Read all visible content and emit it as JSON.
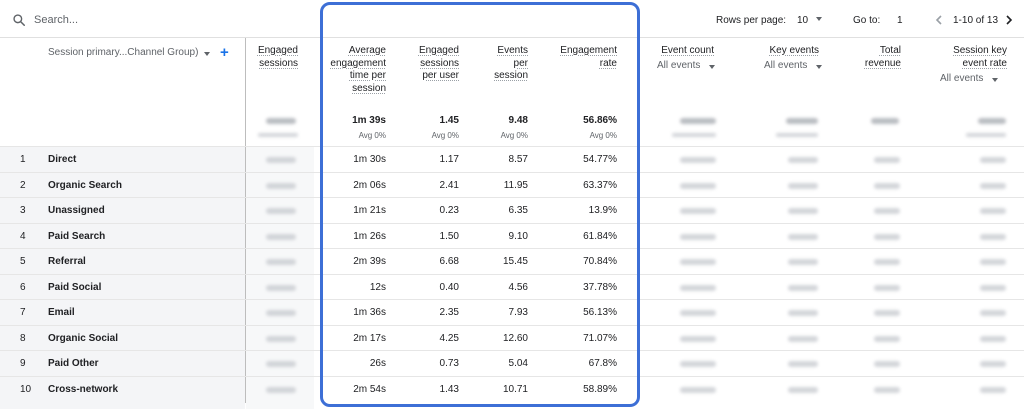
{
  "search": {
    "placeholder": "Search..."
  },
  "pagination": {
    "rows_per_page_label": "Rows per page:",
    "rows_per_page_value": "10",
    "goto_label": "Go to:",
    "goto_value": "1",
    "range_label": "1-10 of 13"
  },
  "dimension": {
    "label": "Session primary...Channel Group)"
  },
  "columns": {
    "engaged_sessions": [
      "Engaged",
      "sessions"
    ],
    "avg_engagement": [
      "Average",
      "engagement",
      "time per",
      "session"
    ],
    "eng_per_user": [
      "Engaged",
      "sessions",
      "per user"
    ],
    "events_per_session": [
      "Events",
      "per",
      "session"
    ],
    "engagement_rate": [
      "Engagement",
      "rate"
    ],
    "event_count": "Event count",
    "event_count_filter": "All events",
    "key_events": "Key events",
    "key_events_filter": "All events",
    "total_revenue": [
      "Total",
      "revenue"
    ],
    "session_key_rate": [
      "Session key",
      "event rate"
    ],
    "session_key_filter": "All events"
  },
  "totals": {
    "avg_engagement": "1m 39s",
    "eng_per_user": "1.45",
    "events_per_session": "9.48",
    "engagement_rate": "56.86%",
    "avg_sub": "Avg 0%"
  },
  "rows": [
    {
      "idx": "1",
      "name": "Direct",
      "avg": "1m 30s",
      "epu": "1.17",
      "eps": "8.57",
      "rate": "54.77%"
    },
    {
      "idx": "2",
      "name": "Organic Search",
      "avg": "2m 06s",
      "epu": "2.41",
      "eps": "11.95",
      "rate": "63.37%"
    },
    {
      "idx": "3",
      "name": "Unassigned",
      "avg": "1m 21s",
      "epu": "0.23",
      "eps": "6.35",
      "rate": "13.9%"
    },
    {
      "idx": "4",
      "name": "Paid Search",
      "avg": "1m 26s",
      "epu": "1.50",
      "eps": "9.10",
      "rate": "61.84%"
    },
    {
      "idx": "5",
      "name": "Referral",
      "avg": "2m 39s",
      "epu": "6.68",
      "eps": "15.45",
      "rate": "70.84%"
    },
    {
      "idx": "6",
      "name": "Paid Social",
      "avg": "12s",
      "epu": "0.40",
      "eps": "4.56",
      "rate": "37.78%"
    },
    {
      "idx": "7",
      "name": "Email",
      "avg": "1m 36s",
      "epu": "2.35",
      "eps": "7.93",
      "rate": "56.13%"
    },
    {
      "idx": "8",
      "name": "Organic Social",
      "avg": "2m 17s",
      "epu": "4.25",
      "eps": "12.60",
      "rate": "71.07%"
    },
    {
      "idx": "9",
      "name": "Paid Other",
      "avg": "26s",
      "epu": "0.73",
      "eps": "5.04",
      "rate": "67.8%"
    },
    {
      "idx": "10",
      "name": "Cross-network",
      "avg": "2m 54s",
      "epu": "1.43",
      "eps": "10.71",
      "rate": "58.89%"
    }
  ],
  "colors": {
    "accent": "#1a73e8",
    "highlight": "#3d6fd6"
  }
}
